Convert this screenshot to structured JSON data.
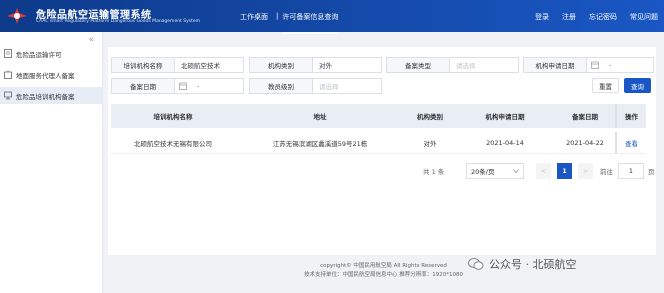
{
  "header": {
    "title": "危险品航空运输管理系统",
    "subtitle": "CAAC smart Regulatory Platform Dangerous Goods Management System",
    "nav": {
      "home": "工作桌面",
      "separator": "|",
      "current": "许可备案信息查询"
    },
    "links": [
      "登录",
      "注册",
      "忘记密码",
      "常见问题"
    ]
  },
  "sidebar": {
    "collapse_glyph": "«",
    "items": [
      {
        "label": "危险品运输许可",
        "icon": "document-icon"
      },
      {
        "label": "地面服务代理人备案",
        "icon": "building-icon"
      },
      {
        "label": "危险品培训机构备案",
        "icon": "training-icon",
        "active": true
      }
    ]
  },
  "filters": {
    "org_name": {
      "label": "培训机构名称",
      "value": "北硕航空技术"
    },
    "org_type": {
      "label": "机构类别",
      "value": "对外"
    },
    "filing_type": {
      "label": "备案类型",
      "placeholder": "请选择"
    },
    "apply_date": {
      "label": "机构申请日期",
      "dash": "-"
    },
    "filing_date": {
      "label": "备案日期",
      "dash": "-"
    },
    "teacher_level": {
      "label": "教员级别",
      "placeholder": "请选择"
    },
    "reset_label": "重置",
    "search_label": "查询"
  },
  "table": {
    "columns": [
      "培训机构名称",
      "地址",
      "机构类别",
      "机构申请日期",
      "备案日期",
      "操作"
    ],
    "rows": [
      {
        "name": "北硕航空技术无锡有限公司",
        "address": "江苏无锡滨湖区蠡溪道59号21栋",
        "type": "对外",
        "apply_date": "2021-04-14",
        "filing_date": "2021-04-22",
        "action": "查看"
      }
    ]
  },
  "pagination": {
    "total": "共 1 条",
    "page_size": "20条/页",
    "prev": "<",
    "current_page": "1",
    "next": ">",
    "goto": "前往",
    "goto_value": "1",
    "unit": "页"
  },
  "footer": {
    "copyright": "copyright© 中国民用航空局 All Rights Reserved",
    "support": "技术支持单位：中国民航空局信息中心 推荐分辨率：1920*1080"
  },
  "watermark": {
    "text": "公众号 · 北硕航空"
  },
  "colors": {
    "header": "#1a57c4",
    "primary": "#1a57c4",
    "sidebar_active": "#e6edf7"
  }
}
